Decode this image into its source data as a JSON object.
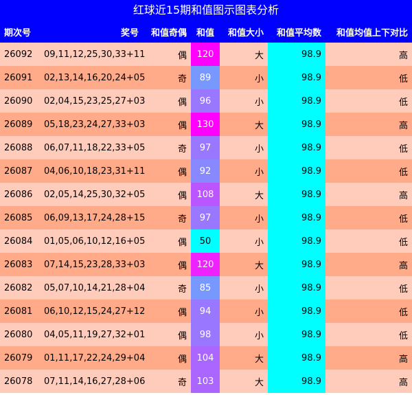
{
  "title": "红球近15期和值图示图表分析",
  "headers": {
    "issue": "期次号",
    "numbers": "奖号",
    "parity": "和值奇偶",
    "sum": "和值",
    "size": "和值大小",
    "avg": "和值平均数",
    "compare": "和值均值上下对比"
  },
  "colors": {
    "header_bg": "#0000ff",
    "row_light": "#ffccbb",
    "row_dark": "#ffaa88",
    "avg_bg": "#00ffff",
    "sum_high": "#ff00ff",
    "sum_mid_high": "#cc44ff",
    "sum_mid": "#aa55ff",
    "sum_low_mid": "#9977ff",
    "sum_low": "#7799ff",
    "sum_lowest": "#00ffff"
  },
  "rows": [
    {
      "issue": "26092",
      "numbers": "09,11,12,25,30,33+11",
      "parity": "偶",
      "sum": "120",
      "size": "大",
      "avg": "98.9",
      "compare": "高",
      "sum_color": "#ff00ff"
    },
    {
      "issue": "26091",
      "numbers": "02,13,14,16,20,24+05",
      "parity": "奇",
      "sum": "89",
      "size": "小",
      "avg": "98.9",
      "compare": "低",
      "sum_color": "#7799ff"
    },
    {
      "issue": "26090",
      "numbers": "02,04,15,23,25,27+03",
      "parity": "偶",
      "sum": "96",
      "size": "小",
      "avg": "98.9",
      "compare": "低",
      "sum_color": "#9977ff"
    },
    {
      "issue": "26089",
      "numbers": "05,18,23,24,27,33+03",
      "parity": "偶",
      "sum": "130",
      "size": "大",
      "avg": "98.9",
      "compare": "高",
      "sum_color": "#ff00ff"
    },
    {
      "issue": "26088",
      "numbers": "06,07,11,18,22,33+05",
      "parity": "奇",
      "sum": "97",
      "size": "小",
      "avg": "98.9",
      "compare": "低",
      "sum_color": "#9977ff"
    },
    {
      "issue": "26087",
      "numbers": "04,06,10,18,23,31+11",
      "parity": "偶",
      "sum": "92",
      "size": "小",
      "avg": "98.9",
      "compare": "低",
      "sum_color": "#8888ff"
    },
    {
      "issue": "26086",
      "numbers": "02,05,14,25,30,32+05",
      "parity": "偶",
      "sum": "108",
      "size": "大",
      "avg": "98.9",
      "compare": "高",
      "sum_color": "#bb55ff"
    },
    {
      "issue": "26085",
      "numbers": "06,09,13,17,24,28+15",
      "parity": "奇",
      "sum": "97",
      "size": "小",
      "avg": "98.9",
      "compare": "低",
      "sum_color": "#9977ff"
    },
    {
      "issue": "26084",
      "numbers": "01,05,06,10,12,16+05",
      "parity": "偶",
      "sum": "50",
      "size": "小",
      "avg": "98.9",
      "compare": "低",
      "sum_color": "#00ffff",
      "sum_text": "#000000"
    },
    {
      "issue": "26083",
      "numbers": "07,14,15,23,28,33+03",
      "parity": "偶",
      "sum": "120",
      "size": "大",
      "avg": "98.9",
      "compare": "高",
      "sum_color": "#ee22ff"
    },
    {
      "issue": "26082",
      "numbers": "05,07,10,14,21,28+04",
      "parity": "奇",
      "sum": "85",
      "size": "小",
      "avg": "98.9",
      "compare": "低",
      "sum_color": "#7799ff"
    },
    {
      "issue": "26081",
      "numbers": "06,10,12,15,24,27+12",
      "parity": "偶",
      "sum": "94",
      "size": "小",
      "avg": "98.9",
      "compare": "低",
      "sum_color": "#9977ff"
    },
    {
      "issue": "26080",
      "numbers": "04,05,11,19,27,32+01",
      "parity": "偶",
      "sum": "98",
      "size": "小",
      "avg": "98.9",
      "compare": "低",
      "sum_color": "#9977ff"
    },
    {
      "issue": "26079",
      "numbers": "01,11,17,22,24,29+04",
      "parity": "偶",
      "sum": "104",
      "size": "大",
      "avg": "98.9",
      "compare": "高",
      "sum_color": "#aa66ff"
    },
    {
      "issue": "26078",
      "numbers": "07,11,14,16,27,28+06",
      "parity": "奇",
      "sum": "103",
      "size": "大",
      "avg": "98.9",
      "compare": "高",
      "sum_color": "#aa66ff"
    }
  ]
}
